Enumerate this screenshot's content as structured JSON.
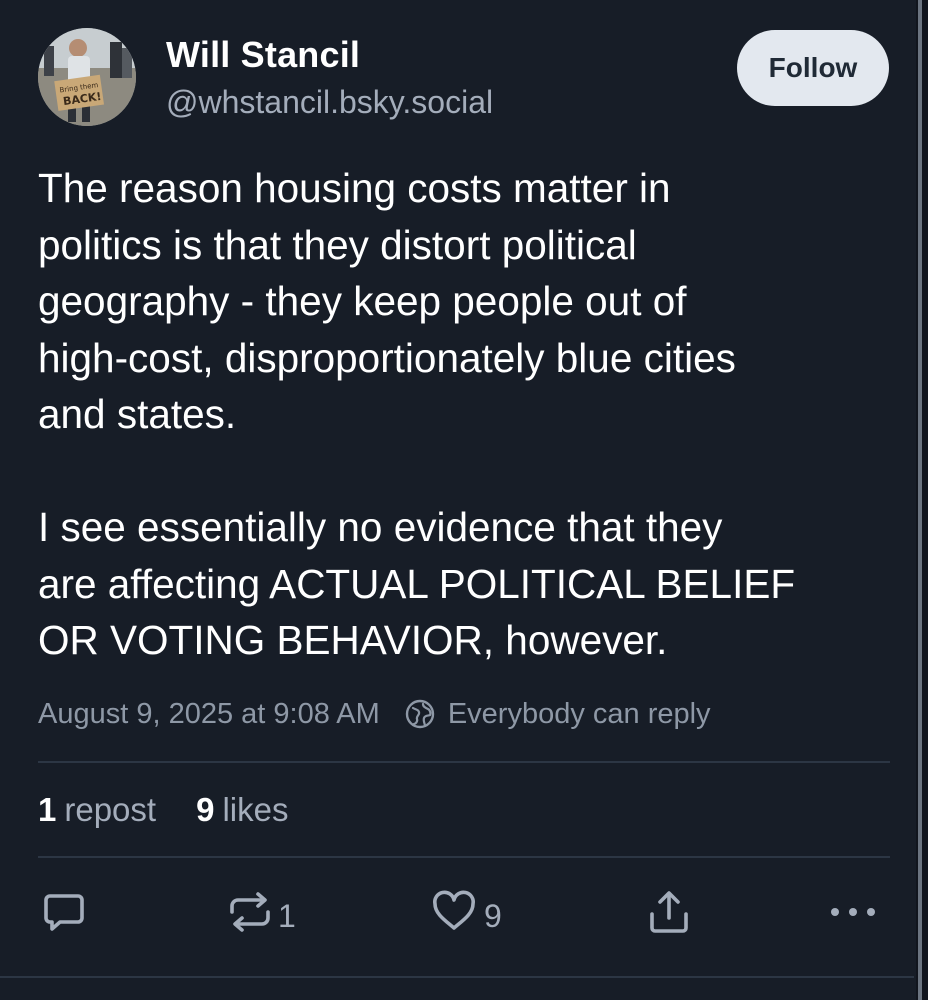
{
  "author": {
    "name": "Will Stancil",
    "handle": "@whstancil.bsky.social",
    "avatar_sign_text": [
      "Bring them",
      "BACK!"
    ]
  },
  "follow_label": "Follow",
  "post": {
    "paragraph_1": "The reason housing costs matter in\npolitics is that they distort political\ngeography - they keep people out of\nhigh-cost, disproportionately blue cities\nand states.",
    "paragraph_2": "I see essentially no evidence that they\nare affecting ACTUAL POLITICAL BELIEF\nOR VOTING BEHAVIOR, however."
  },
  "meta": {
    "timestamp": "August 9, 2025 at 9:08 AM",
    "reply_setting": "Everybody can reply",
    "reply_icon": "globe-icon"
  },
  "stats": {
    "reposts_count": "1",
    "reposts_label": "repost",
    "likes_count": "9",
    "likes_label": "likes"
  },
  "actions": {
    "reply_icon": "speech-bubble-icon",
    "repost_icon": "repost-arrows-icon",
    "repost_count": "1",
    "like_icon": "heart-icon",
    "like_count": "9",
    "share_icon": "share-upload-icon",
    "more_icon": "ellipsis-icon"
  },
  "colors": {
    "background": "#171d27",
    "primary_text": "#ffffff",
    "secondary_text": "#a4adbb",
    "follow_button_bg": "#e3e8ef",
    "follow_button_text": "#202a36",
    "divider": "#2c3644"
  }
}
